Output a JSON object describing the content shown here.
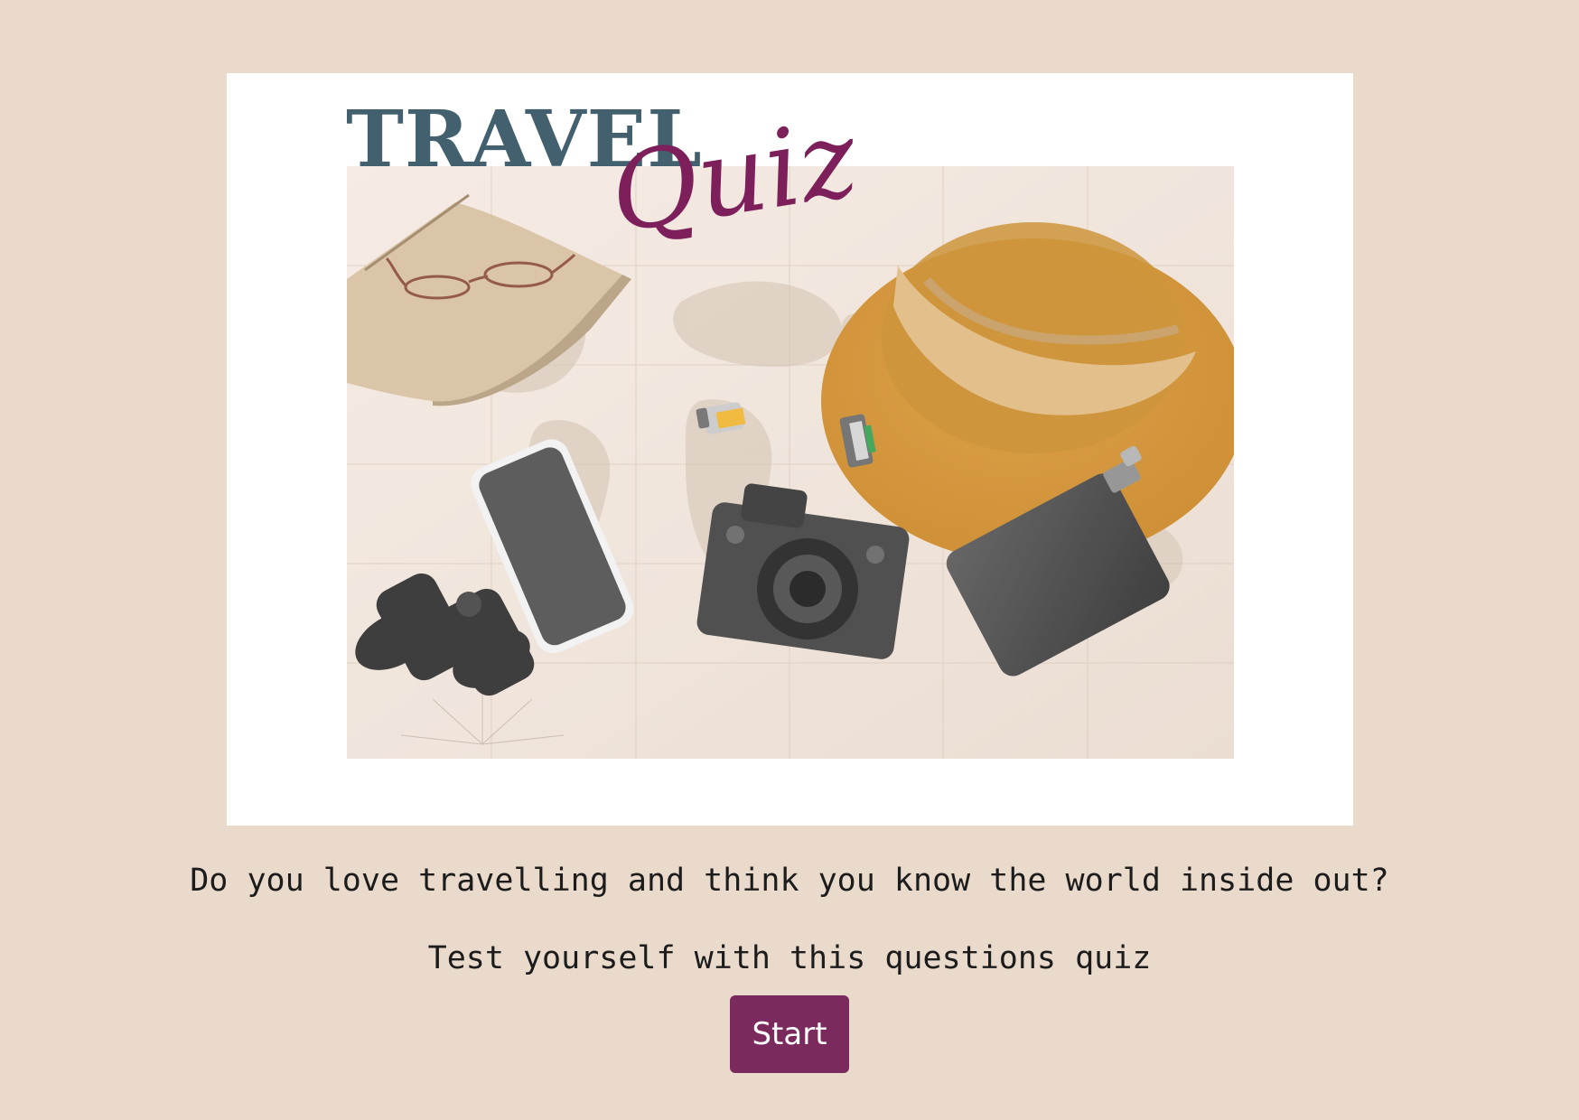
{
  "hero": {
    "title_travel": "TRAVEL",
    "title_quiz": "Quiz"
  },
  "intro": {
    "line1": "Do you love travelling and think you know the world inside out?",
    "line2": "Test yourself with this questions quiz"
  },
  "start_button": {
    "label": "Start"
  },
  "colors": {
    "page_background": "#eadacc",
    "card_background": "#ffffff",
    "title_travel": "#42606e",
    "title_quiz": "#7c1f5a",
    "button_background": "#7a2a5d",
    "button_text": "#ffffff",
    "body_text": "#1c1c1c"
  }
}
